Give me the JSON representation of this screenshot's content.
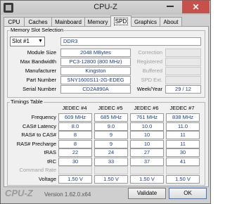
{
  "window": {
    "title": "CPU-Z",
    "close_glyph": "✕"
  },
  "tabs": [
    {
      "label": "CPU"
    },
    {
      "label": "Caches"
    },
    {
      "label": "Mainboard"
    },
    {
      "label": "Memory"
    },
    {
      "label": "SPD",
      "active": true
    },
    {
      "label": "Graphics"
    },
    {
      "label": "About"
    }
  ],
  "memory_slot": {
    "section_title": "Memory Slot Selection",
    "slot_selected": "Slot #1",
    "memory_type": "DDR3",
    "fields": [
      {
        "label": "Module Size",
        "value": "2048 MBytes"
      },
      {
        "label": "Max Bandwidth",
        "value": "PC3-12800 (800 MHz)"
      },
      {
        "label": "Manufacturer",
        "value": "Kingston"
      },
      {
        "label": "Part Number",
        "value": "SNY1600S11-2G-EDEG"
      },
      {
        "label": "Serial Number",
        "value": "CD2A890A"
      }
    ],
    "right_fields": [
      {
        "label": "Correction",
        "value": ""
      },
      {
        "label": "Registered",
        "value": ""
      },
      {
        "label": "Buffered",
        "value": ""
      },
      {
        "label": "SPD Ext.",
        "value": ""
      },
      {
        "label": "Week/Year",
        "value": "29 / 12"
      }
    ]
  },
  "timings": {
    "section_title": "Timings Table",
    "columns": [
      "JEDEC #4",
      "JEDEC #5",
      "JEDEC #6",
      "JEDEC #7"
    ],
    "rows": [
      {
        "label": "Frequency",
        "values": [
          "609 MHz",
          "685 MHz",
          "761 MHz",
          "838 MHz"
        ]
      },
      {
        "label": "CAS# Latency",
        "values": [
          "8.0",
          "9.0",
          "10.0",
          "11.0"
        ]
      },
      {
        "label": "RAS# to CAS#",
        "values": [
          "8",
          "9",
          "10",
          "11"
        ]
      },
      {
        "label": "RAS# Precharge",
        "values": [
          "8",
          "9",
          "10",
          "11"
        ]
      },
      {
        "label": "tRAS",
        "values": [
          "22",
          "24",
          "27",
          "30"
        ]
      },
      {
        "label": "tRC",
        "values": [
          "30",
          "33",
          "37",
          "41"
        ]
      },
      {
        "label": "Command Rate",
        "values": [
          "",
          "",
          "",
          ""
        ],
        "dim": true
      },
      {
        "label": "Voltage",
        "values": [
          "1.50 V",
          "1.50 V",
          "1.50 V",
          "1.50 V"
        ]
      }
    ]
  },
  "footer": {
    "brand": "CPU-Z",
    "version": "Version 1.62.0.x64",
    "validate_label": "Validate",
    "ok_label": "OK"
  }
}
